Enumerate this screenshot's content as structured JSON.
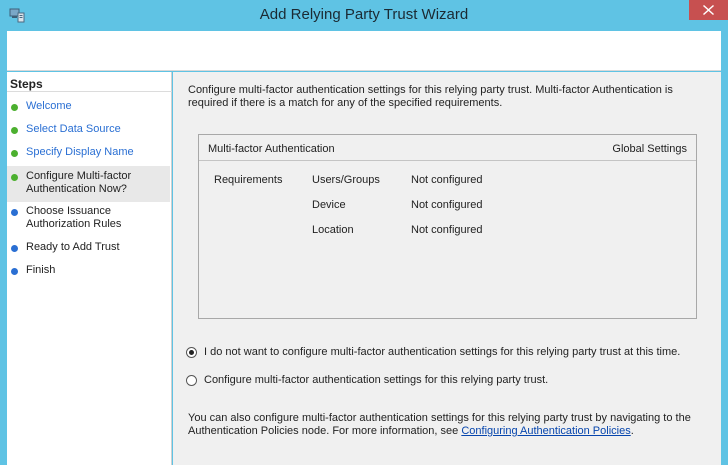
{
  "window": {
    "title": "Add Relying Party Trust Wizard"
  },
  "steps": {
    "heading": "Steps",
    "items": [
      {
        "label": "Welcome",
        "state": "done"
      },
      {
        "label": "Select Data Source",
        "state": "done"
      },
      {
        "label": "Specify Display Name",
        "state": "done"
      },
      {
        "label": "Configure Multi-factor Authentication Now?",
        "state": "current"
      },
      {
        "label": "Choose Issuance Authorization Rules",
        "state": "todo"
      },
      {
        "label": "Ready to Add Trust",
        "state": "todo"
      },
      {
        "label": "Finish",
        "state": "todo"
      }
    ]
  },
  "content": {
    "intro": "Configure multi-factor authentication settings for this relying party trust. Multi-factor Authentication is required if there is a match for any of the specified requirements.",
    "mfa_table": {
      "header_left": "Multi-factor Authentication",
      "header_right": "Global Settings",
      "requirements_label": "Requirements",
      "rows": [
        {
          "name": "Users/Groups",
          "value": "Not configured"
        },
        {
          "name": "Device",
          "value": "Not configured"
        },
        {
          "name": "Location",
          "value": "Not configured"
        }
      ]
    },
    "options": [
      {
        "label": "I do not want to configure multi-factor authentication settings for this relying party trust at this time.",
        "checked": true
      },
      {
        "label": "Configure multi-factor authentication settings for this relying party trust.",
        "checked": false
      }
    ],
    "footer_text": "You can also configure multi-factor authentication settings for this relying party trust by navigating to the Authentication Policies node. For more information, see",
    "footer_link": "Configuring Authentication Policies",
    "footer_end": "."
  },
  "colors": {
    "titlebar": "#5fc3e4",
    "close_button": "#c75050",
    "step_done_dot": "#4cb02f",
    "step_todo_dot": "#2a6fd3",
    "link": "#0645ad"
  },
  "icons": {
    "app": "server-wizard-icon",
    "close": "close-icon"
  }
}
